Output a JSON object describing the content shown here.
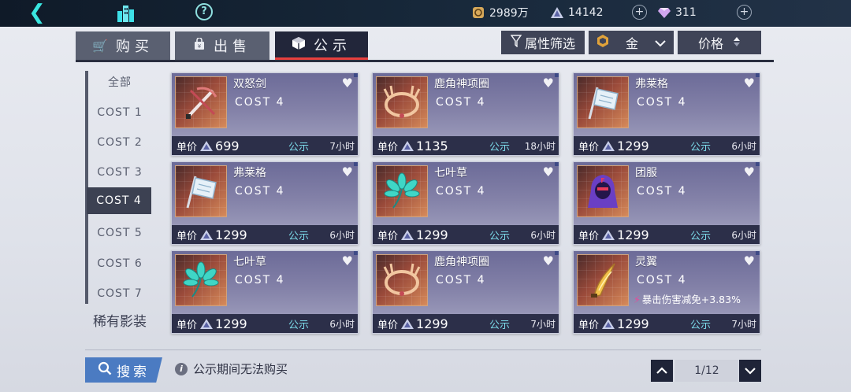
{
  "topbar": {
    "gold": "2989万",
    "crystals": "14142",
    "diamonds": "311"
  },
  "tabs": [
    {
      "label": "购买",
      "icon": "cart-icon"
    },
    {
      "label": "出售",
      "icon": "bag-icon"
    },
    {
      "label": "公示",
      "icon": "cube-icon",
      "active": true
    }
  ],
  "filters": {
    "attr_label": "属性筛选",
    "rarity_value": "金",
    "sort_label": "价格"
  },
  "sidebar": {
    "items": [
      "全部",
      "COST 1",
      "COST 2",
      "COST 3",
      "COST 4",
      "COST 5",
      "COST 6",
      "COST 7"
    ],
    "active_index": 4,
    "rare": "稀有影装"
  },
  "cards": [
    {
      "name": "双怒剑",
      "cost": "COST 4",
      "price_label": "单价",
      "price": "699",
      "status": "公示",
      "time": "7小时",
      "icon": "dual-blade-icon"
    },
    {
      "name": "鹿角神项圈",
      "cost": "COST 4",
      "price_label": "单价",
      "price": "1135",
      "status": "公示",
      "time": "18小时",
      "icon": "antler-collar-icon"
    },
    {
      "name": "弗莱格",
      "cost": "COST 4",
      "price_label": "单价",
      "price": "1299",
      "status": "公示",
      "time": "6小时",
      "icon": "flag-icon"
    },
    {
      "name": "弗莱格",
      "cost": "COST 4",
      "price_label": "单价",
      "price": "1299",
      "status": "公示",
      "time": "6小时",
      "icon": "flag-icon"
    },
    {
      "name": "七叶草",
      "cost": "COST 4",
      "price_label": "单价",
      "price": "1299",
      "status": "公示",
      "time": "6小时",
      "icon": "seven-leaf-clover-icon"
    },
    {
      "name": "团服",
      "cost": "COST 4",
      "price_label": "单价",
      "price": "1299",
      "status": "公示",
      "time": "6小时",
      "icon": "team-uniform-icon"
    },
    {
      "name": "七叶草",
      "cost": "COST 4",
      "price_label": "单价",
      "price": "1299",
      "status": "公示",
      "time": "6小时",
      "icon": "seven-leaf-clover-icon"
    },
    {
      "name": "鹿角神项圈",
      "cost": "COST 4",
      "price_label": "单价",
      "price": "1299",
      "status": "公示",
      "time": "7小时",
      "icon": "antler-collar-icon"
    },
    {
      "name": "灵翼",
      "cost": "COST 4",
      "bonus": "暴击伤害减免+3.83%",
      "price_label": "单价",
      "price": "1299",
      "status": "公示",
      "time": "7小时",
      "icon": "spirit-wing-icon"
    }
  ],
  "bottom": {
    "search_label": "搜索",
    "notice": "公示期间无法购买",
    "page": "1/12"
  },
  "colors": {
    "accent_red": "#e8403e",
    "status_cyan": "#7bd9e8",
    "search_blue": "#4b7bc2",
    "bonus_pink": "#e84a9a"
  }
}
